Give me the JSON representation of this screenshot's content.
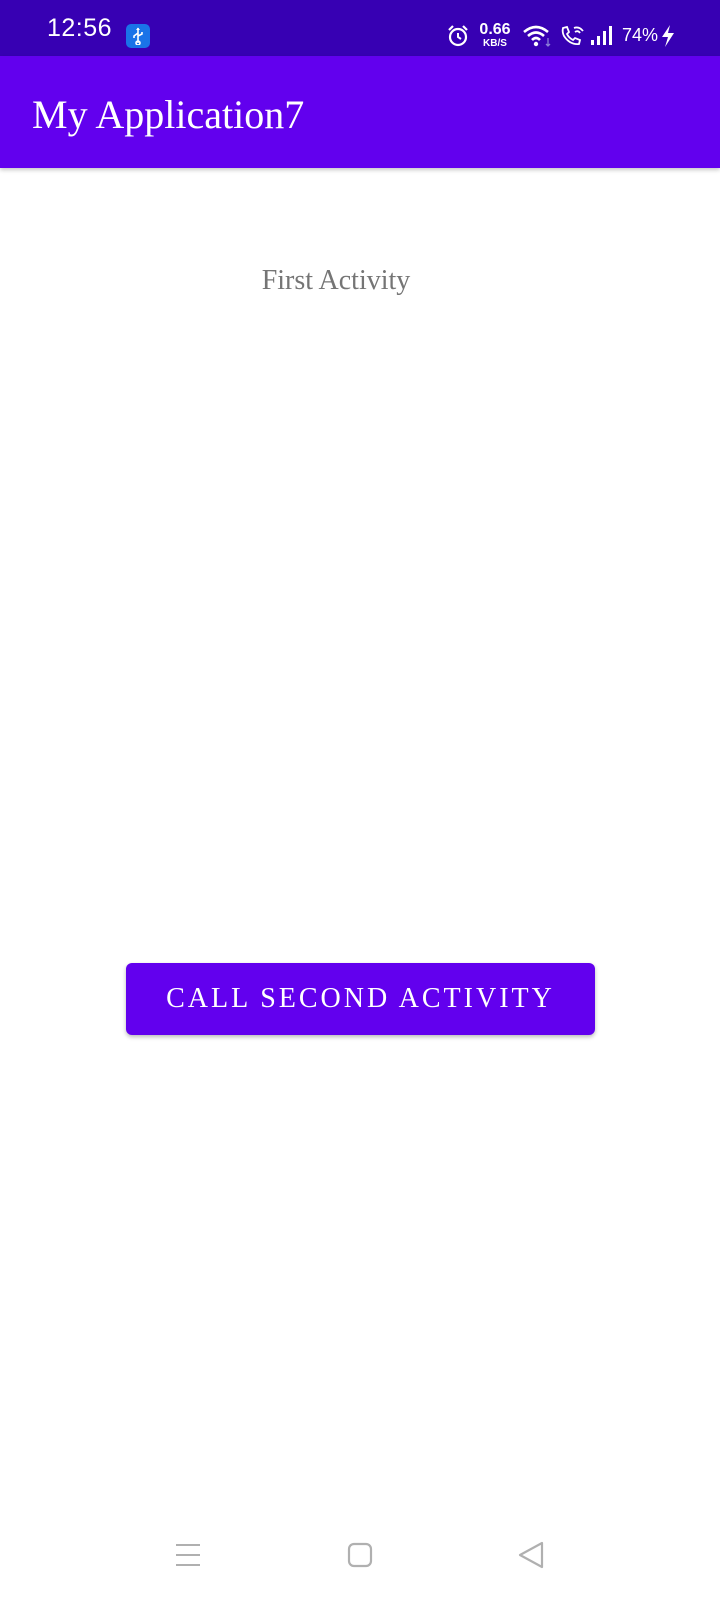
{
  "status_bar": {
    "time": "12:56",
    "net_speed_value": "0.66",
    "net_speed_unit": "KB/S",
    "battery": "74%",
    "icons": [
      "usb-debug-icon",
      "alarm-icon",
      "wifi-icon",
      "wifi-calling-icon",
      "signal-icon",
      "charging-icon"
    ]
  },
  "app_bar": {
    "title": "My Application7"
  },
  "main": {
    "label": "First Activity",
    "button_label": "CALL SECOND ACTIVITY"
  },
  "nav_bar": {
    "icons": [
      "menu-icon",
      "home-icon",
      "back-icon"
    ]
  },
  "colors": {
    "status_bar": "#3700b3",
    "primary": "#6200ee",
    "label_text": "#757575",
    "background": "#ffffff"
  }
}
